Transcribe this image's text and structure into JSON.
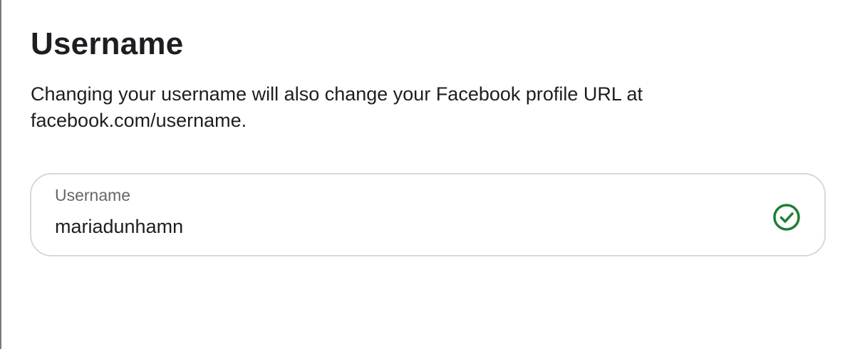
{
  "page": {
    "title": "Username",
    "description": "Changing your username will also change your Facebook profile URL at facebook.com/username."
  },
  "username_field": {
    "label": "Username",
    "value": "mariadunhamn",
    "status_icon": "check-circle-icon",
    "status_color": "#1e7e34"
  }
}
